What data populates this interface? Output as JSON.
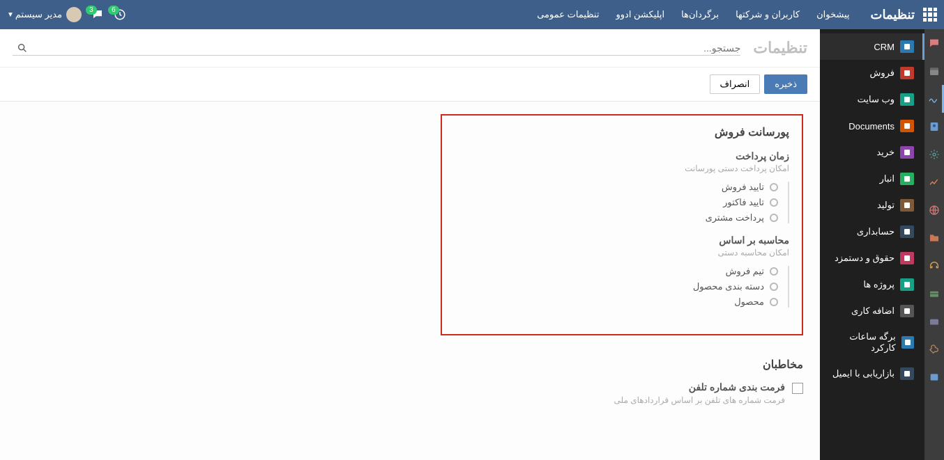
{
  "topbar": {
    "title": "تنظیمات",
    "menu": [
      "پیشخوان",
      "کاربران و شرکتها",
      "برگردان‌ها",
      "اپلیکشن ادوو",
      "تنظیمات عمومی"
    ],
    "badge1": "6",
    "badge2": "3",
    "user": "مدیر سیستم"
  },
  "page": {
    "title": "تنظیمات",
    "search_placeholder": "جستجو...",
    "save": "ذخیره",
    "cancel": "انصراف"
  },
  "sidebar": [
    {
      "label": "CRM",
      "cls": "c-blue"
    },
    {
      "label": "فروش",
      "cls": "c-red"
    },
    {
      "label": "وب سایت",
      "cls": "c-teal"
    },
    {
      "label": "Documents",
      "cls": "c-orange"
    },
    {
      "label": "خرید",
      "cls": "c-purple"
    },
    {
      "label": "انبار",
      "cls": "c-green"
    },
    {
      "label": "تولید",
      "cls": "c-brown"
    },
    {
      "label": "حسابداری",
      "cls": "c-navy"
    },
    {
      "label": "حقوق و دستمزد",
      "cls": "c-pink"
    },
    {
      "label": "پروژه ها",
      "cls": "c-teal"
    },
    {
      "label": "اضافه کاری",
      "cls": "c-gray"
    },
    {
      "label": "برگه ساعات کارکرد",
      "cls": "c-blue"
    },
    {
      "label": "بازاریابی با ایمیل",
      "cls": "c-navy"
    }
  ],
  "commission": {
    "title": "پورسانت فروش",
    "pay_time": {
      "title": "زمان پرداخت",
      "desc": "امکان پرداخت دستی پورسانت",
      "opts": [
        "تایید فروش",
        "تایید فاکتور",
        "پرداخت مشتری"
      ]
    },
    "calc": {
      "title": "محاسبه بر اساس",
      "desc": "امکان محاسبه دستی",
      "opts": [
        "تیم فروش",
        "دسته بندی محصول",
        "محصول"
      ]
    }
  },
  "contacts": {
    "title": "مخاطبان",
    "phone_fmt": {
      "label": "فرمت بندی شماره تلفن",
      "desc": "فرمت شماره های تلفن بر اساس قراردادهای ملی"
    }
  }
}
